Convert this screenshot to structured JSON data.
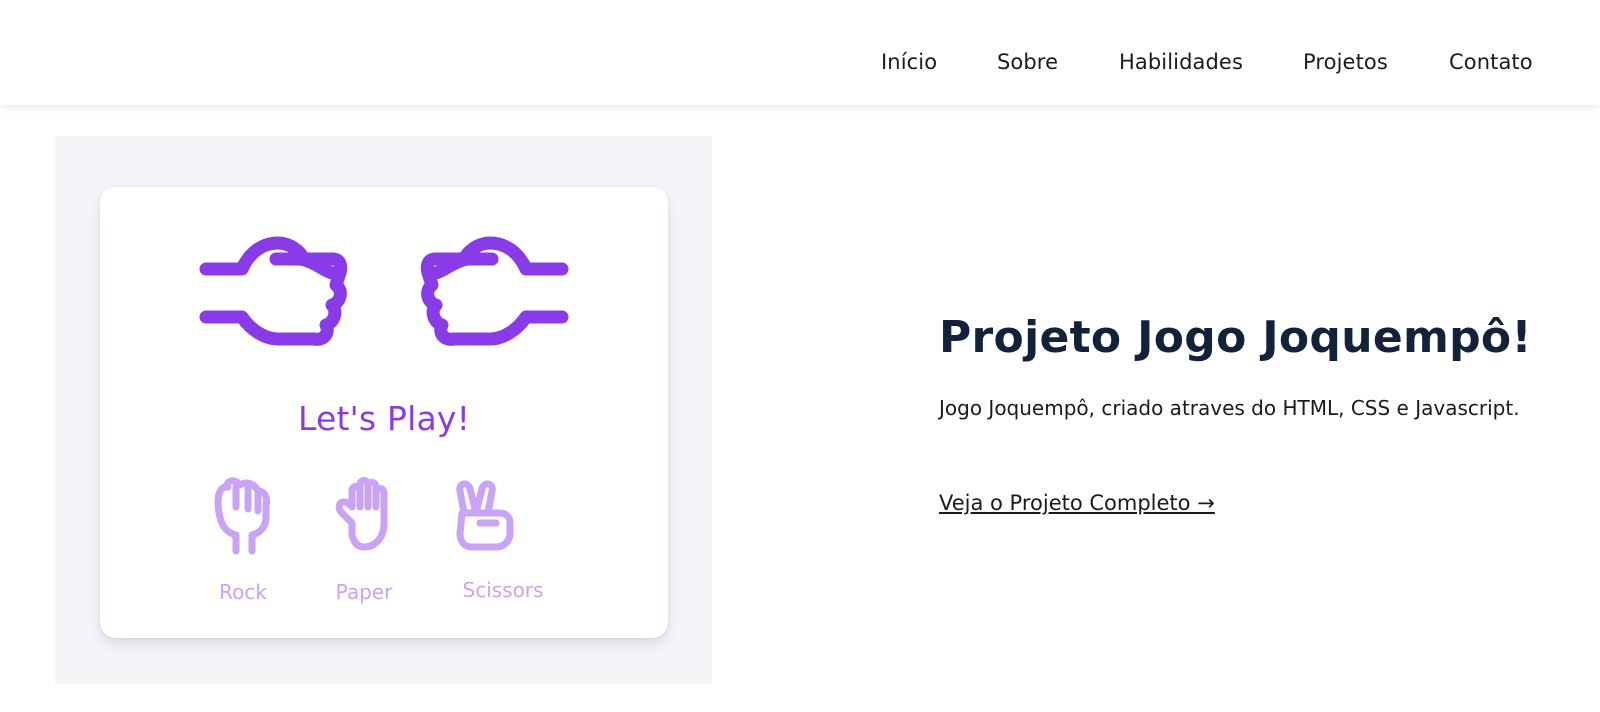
{
  "nav": {
    "items": [
      {
        "label": "Início"
      },
      {
        "label": "Sobre"
      },
      {
        "label": "Habilidades"
      },
      {
        "label": "Projetos"
      },
      {
        "label": "Contato"
      }
    ]
  },
  "preview": {
    "heading": "Let's Play!",
    "choices": [
      {
        "label": "Rock",
        "icon": "rock-hand-icon"
      },
      {
        "label": "Paper",
        "icon": "paper-hand-icon"
      },
      {
        "label": "Scissors",
        "icon": "scissors-hand-icon"
      }
    ],
    "top_icons": [
      "left-fist-icon",
      "right-fist-icon"
    ]
  },
  "project": {
    "title": "Projeto Jogo Joquempô!",
    "description": "Jogo Joquempô, criado atraves do HTML, CSS e Javascript.",
    "link_label": "Veja o Projeto Completo →"
  },
  "colors": {
    "accent": "#8a3be8",
    "accent_light": "#c9a3f5",
    "title": "#13223a",
    "frame_bg": "#f4f5f9"
  }
}
